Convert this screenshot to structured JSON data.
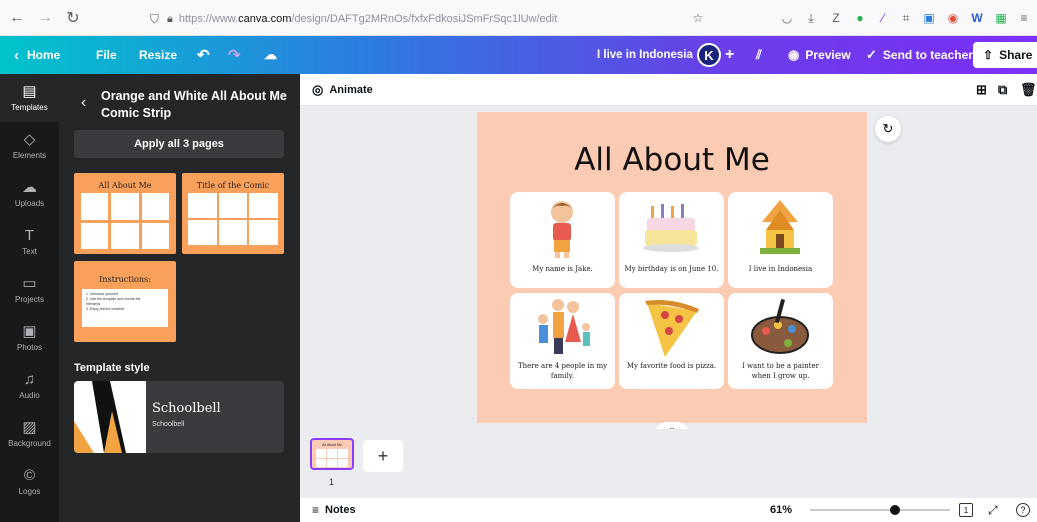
{
  "browser": {
    "url_prefix": "https://www.",
    "url_domain": "canva.com",
    "url_path": "/design/DAFTg2MRnOs/fxfxFdkosiJSmFrSqc1lUw/edit"
  },
  "topbar": {
    "home": "Home",
    "file": "File",
    "resize": "Resize",
    "design_title": "I live in Indonesia",
    "avatar_letter": "K",
    "preview": "Preview",
    "send": "Send to teacher",
    "share": "Share"
  },
  "rail": [
    {
      "label": "Templates",
      "icon": "templates-icon"
    },
    {
      "label": "Elements",
      "icon": "elements-icon"
    },
    {
      "label": "Uploads",
      "icon": "uploads-icon"
    },
    {
      "label": "Text",
      "icon": "text-icon"
    },
    {
      "label": "Projects",
      "icon": "folder-icon"
    },
    {
      "label": "Photos",
      "icon": "photos-icon"
    },
    {
      "label": "Audio",
      "icon": "audio-icon"
    },
    {
      "label": "Background",
      "icon": "background-icon"
    },
    {
      "label": "Logos",
      "icon": "logos-icon"
    }
  ],
  "panel": {
    "title": "Orange and White All About Me Comic Strip",
    "apply": "Apply all 3 pages",
    "thumb1_title": "All About Me",
    "thumb2_title": "Title of the Comic",
    "thumb3_title": "Instructions:",
    "thumb3_lines": [
      "1. Introduce yourself",
      "2. Use the template and rewrite the",
      "elements",
      "3. Enjoy and be creative!"
    ],
    "style_header": "Template style",
    "style_name": "Schoolbell",
    "style_sub": "Schoolbell"
  },
  "toolbar": {
    "animate": "Animate"
  },
  "page": {
    "heading": "All About Me",
    "cards": [
      "My name is Jake.",
      "My birthday is on June 10.",
      "I live in Indonesia",
      "There are 4 people in my family.",
      "My favorite food is pizza.",
      "I want to be a painter when I grow up."
    ]
  },
  "pages": {
    "thumb_label": "All About Me",
    "page_number": "1"
  },
  "bottom": {
    "notes": "Notes",
    "zoom": "61%",
    "zoom_level": 0.61,
    "page_count": "1"
  },
  "colors": {
    "accent": "#8b3dff",
    "page_bg": "#fbcbb4",
    "thumb_orange": "#f9a05a"
  }
}
